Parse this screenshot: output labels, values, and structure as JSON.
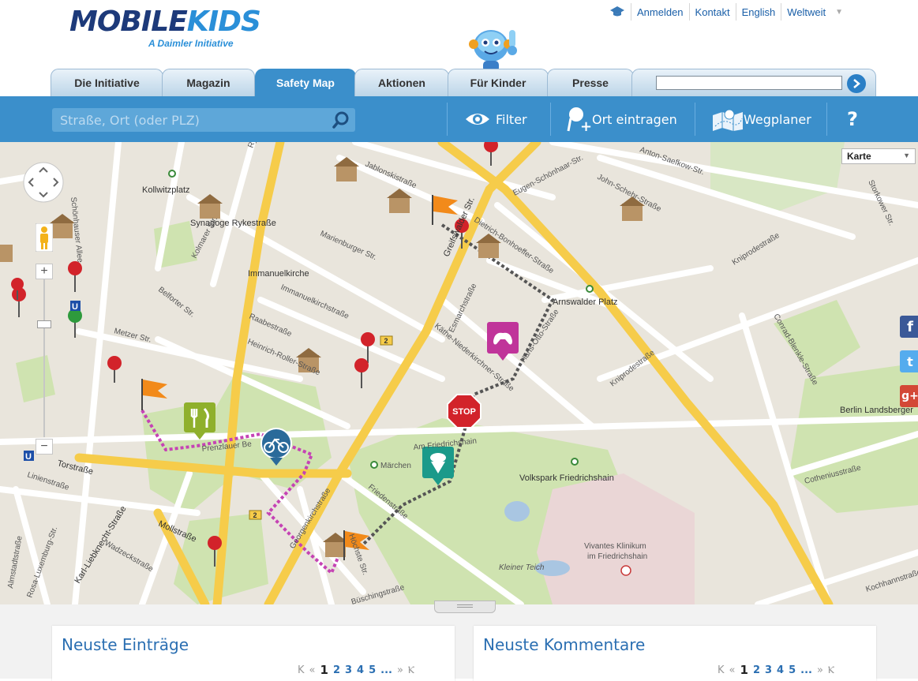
{
  "logo": {
    "brand_part1": "MOBILE",
    "brand_part2": "KIDS",
    "tagline": "A Daimler Initiative"
  },
  "top_nav": {
    "login": "Anmelden",
    "contact": "Kontakt",
    "language": "English",
    "worldwide": "Weltweit"
  },
  "tabs": [
    "Die Initiative",
    "Magazin",
    "Safety Map",
    "Aktionen",
    "Für Kinder",
    "Presse"
  ],
  "active_tab": "Safety Map",
  "site_search": {
    "value": ""
  },
  "toolbar": {
    "search_placeholder": "Straße, Ort (oder PLZ)",
    "filter_label": "Filter",
    "add_place_label": "Ort eintragen",
    "route_planner_label": "Wegplaner",
    "help_label": "?"
  },
  "map": {
    "map_type": "Karte",
    "labels": {
      "kollwitzplatz": "Kollwitzplatz",
      "synagoge": "Synagoge Rykestraße",
      "immanuelkirche": "Immanuelkirche",
      "marienburger": "Marienburger Str.",
      "immanuelkirchstrasse": "Immanuelkirchstraße",
      "raabestrasse": "Raabestraße",
      "heinrich": "Heinrich-Roller-Straße",
      "metzer": "Metzer Str.",
      "belforter": "Belforter Str.",
      "kolmarer": "Kolmarer Str.",
      "schoenhauser": "Schönhauser Allee",
      "rykestrasse": "Rykestraße",
      "jablonski": "Jablonskistraße",
      "greifswalder": "Greifswalder Str.",
      "dietrich": "Dietrich-Bonhoeffer-Straße",
      "arnswalder": "Arnswalder Platz",
      "kniprode1": "Kniprodestraße",
      "kniprode2": "Kniprodestraße",
      "conrad": "Conrad-Blenkle-Straße",
      "kaethe": "Käthe-Niederkirchner-Straße",
      "esmarch": "Esmarchstraße",
      "hansotto": "Hans-Otto-Straße",
      "amfriedrichshain": "Am Friedrichshain",
      "maerchen": "Märchen",
      "volkspark": "Volkspark Friedrichshain",
      "friedenstrasse": "Friedenstraße",
      "georgenkirch": "Georgenkirchstraße",
      "mollstrasse": "Mollstraße",
      "karl": "Karl-Liebknecht-Straße",
      "torstrasse": "Torstraße",
      "vivantes1": "Vivantes Klinikum",
      "vivantes2": "im Friedrichshain",
      "kleinerteich": "Kleiner Teich",
      "berlin": "Berlin Landsberger",
      "prenzlauer": "Prenzlauer Be",
      "stop": "STOP",
      "road_num": "2",
      "cotheniusstrasse": "Cotheniusstraße",
      "kochhannstrasse": "Kochhannstraße",
      "saefkow": "Anton-Saefkow-Str.",
      "johnschehr": "John-Schehr-Straße",
      "hoechste": "Höchste Str.",
      "wadzeck": "Wadzeckstraße",
      "rosaluxemburg": "Rosa-Luxemburg-Str.",
      "almstadt": "Almstadtstraße",
      "linien": "Linienstraße",
      "buesching": "Büschingstraße",
      "orkower": "Storkower Str.",
      "eugen": "Eugen-Schönhaar-Str.",
      "u_station": "U"
    }
  },
  "social": {
    "facebook": "f",
    "twitter": "t",
    "googleplus": "g+"
  },
  "panels": {
    "left_title": "Neuste Einträge",
    "right_title": "Neuste Kommentare",
    "pager": {
      "first": "K",
      "prev": "«",
      "pages": [
        "1",
        "2",
        "3",
        "4",
        "5"
      ],
      "ellipsis": "...",
      "next": "»",
      "last": "Ⲕ",
      "current": "1"
    }
  },
  "colors": {
    "brand_blue": "#3b8fcb",
    "logo_dark": "#1d3a7a",
    "logo_light": "#2a8fd8",
    "road_yellow": "#f6cc4a",
    "park_green": "#cfe3b0",
    "route_magenta": "#c543b4",
    "route_gray": "#555555"
  }
}
